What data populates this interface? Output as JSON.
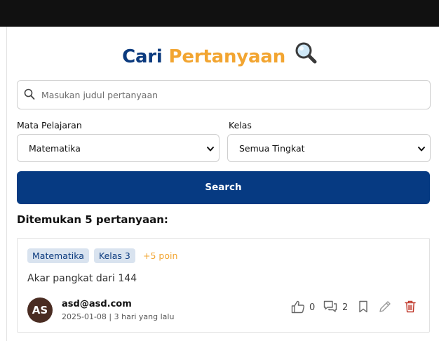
{
  "title": {
    "part1": "Cari",
    "part2": "Pertanyaan"
  },
  "search": {
    "placeholder": "Masukan judul pertanyaan",
    "value": ""
  },
  "filters": {
    "subject_label": "Mata Pelajaran",
    "subject_value": "Matematika",
    "grade_label": "Kelas",
    "grade_value": "Semua Tingkat"
  },
  "search_button": "Search",
  "results_text": "Ditemukan 5 pertanyaan:",
  "question": {
    "tag_subject": "Matematika",
    "tag_grade": "Kelas 3",
    "points": "+5 poin",
    "text": "Akar pangkat dari 144",
    "avatar_initials": "AS",
    "author": "asd@asd.com",
    "meta": "2025-01-08 | 3 hari yang lalu",
    "likes": "0",
    "comments": "2"
  },
  "colors": {
    "brand_blue": "#063a82",
    "accent_orange": "#f2a531",
    "delete_red": "#c0392b"
  },
  "icons": [
    "magnifier-emoji-icon",
    "search-icon",
    "chevron-down-icon",
    "thumbs-up-icon",
    "comments-icon",
    "bookmark-icon",
    "edit-icon",
    "trash-icon"
  ]
}
